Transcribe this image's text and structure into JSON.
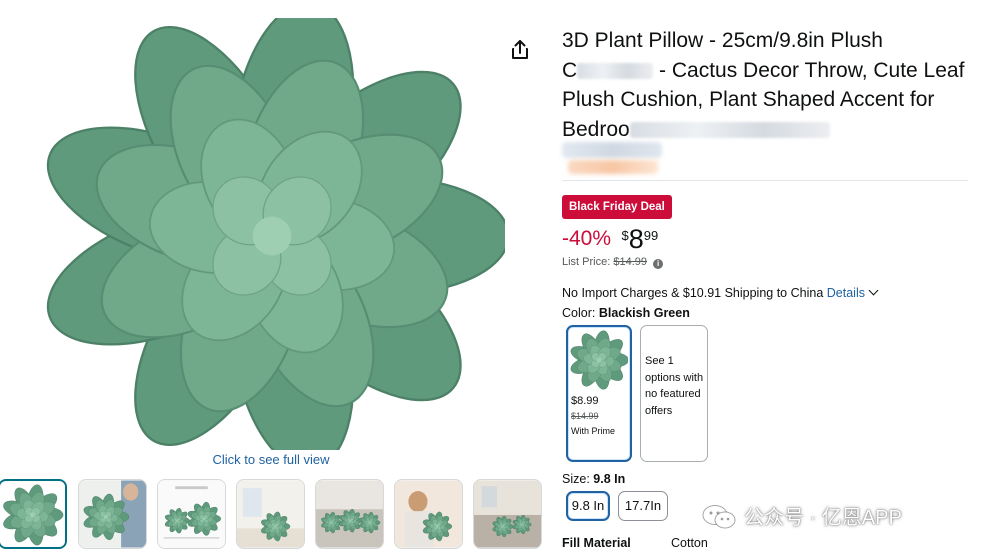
{
  "product": {
    "title_line1": "3D Plant Pillow - 25cm/9.8in Plush",
    "title_line2_start": "C",
    "title_line2_end": "- Cactus Decor Throw, Cute Leaf",
    "title_line3": "Plush Cushion, Plant Shaped Accent for",
    "title_line4_start": "Bedroo"
  },
  "media": {
    "main_image_icon": "succulent-pillow-image",
    "full_view_label": "Click to see full view",
    "thumbnail_count": 7
  },
  "pricing": {
    "deal_badge": "Black Friday Deal",
    "discount": "-40%",
    "currency_symbol": "$",
    "price_whole": "8",
    "price_fraction": "99",
    "list_price_label": "List Price:",
    "list_price_value": "$14.99",
    "info_glyph": "i"
  },
  "shipping": {
    "text": "No Import Charges & $10.91 Shipping to China",
    "details_link": "Details"
  },
  "color": {
    "label": "Color:",
    "selected": "Blackish Green",
    "swatch_price": "$8.99",
    "swatch_list_price": "$14.99",
    "swatch_note": "With Prime",
    "other_options": "See 1 options with no featured offers"
  },
  "size": {
    "label": "Size:",
    "selected": "9.8 In",
    "options": [
      "9.8 In",
      "17.7In"
    ]
  },
  "specs": {
    "fill_material_label": "Fill Material",
    "fill_material_value": "Cotton"
  },
  "watermark": {
    "text": "公众号 · 亿恩APP"
  },
  "colors": {
    "deal_red": "#cc0c39",
    "link_blue": "#2162a1",
    "selected_border": "#2162a1",
    "plant_green": "#6fa487"
  }
}
